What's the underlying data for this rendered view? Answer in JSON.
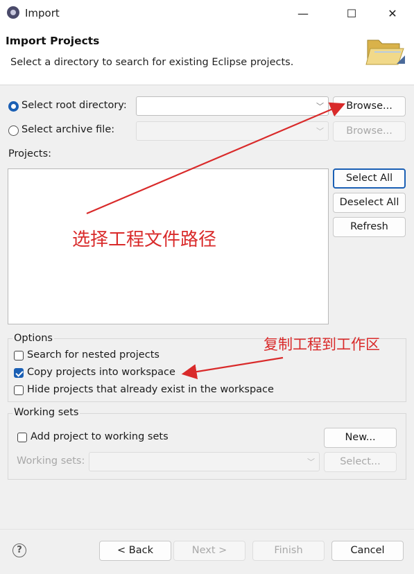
{
  "window": {
    "title": "Import",
    "minimize_glyph": "—",
    "maximize_glyph": "☐",
    "close_glyph": "✕"
  },
  "header": {
    "title": "Import Projects",
    "description": "Select a directory to search for existing Eclipse projects.",
    "icon": "folder-icon"
  },
  "source": {
    "root_label": "Select root directory:",
    "root_value": "",
    "root_selected": true,
    "archive_label": "Select archive file:",
    "archive_value": "",
    "archive_selected": false,
    "browse_label": "Browse...",
    "browse_archive_label": "Browse..."
  },
  "projects": {
    "label": "Projects:",
    "items": [],
    "select_all_label": "Select All",
    "deselect_all_label": "Deselect All",
    "refresh_label": "Refresh"
  },
  "options": {
    "title": "Options",
    "search_nested_label": "Search for nested projects",
    "search_nested_checked": false,
    "copy_projects_label": "Copy projects into workspace",
    "copy_projects_checked": true,
    "hide_existing_label": "Hide projects that already exist in the workspace",
    "hide_existing_checked": false
  },
  "working_sets": {
    "title": "Working sets",
    "add_label": "Add project to working sets",
    "add_checked": false,
    "new_label": "New...",
    "sets_label": "Working sets:",
    "sets_value": "",
    "select_label": "Select..."
  },
  "annotations": {
    "path_note": "选择工程文件路径",
    "copy_note": "复制工程到工作区",
    "color": "#d92a2a"
  },
  "footer": {
    "help_glyph": "?",
    "back_label": "< Back",
    "next_label": "Next >",
    "finish_label": "Finish",
    "cancel_label": "Cancel"
  }
}
